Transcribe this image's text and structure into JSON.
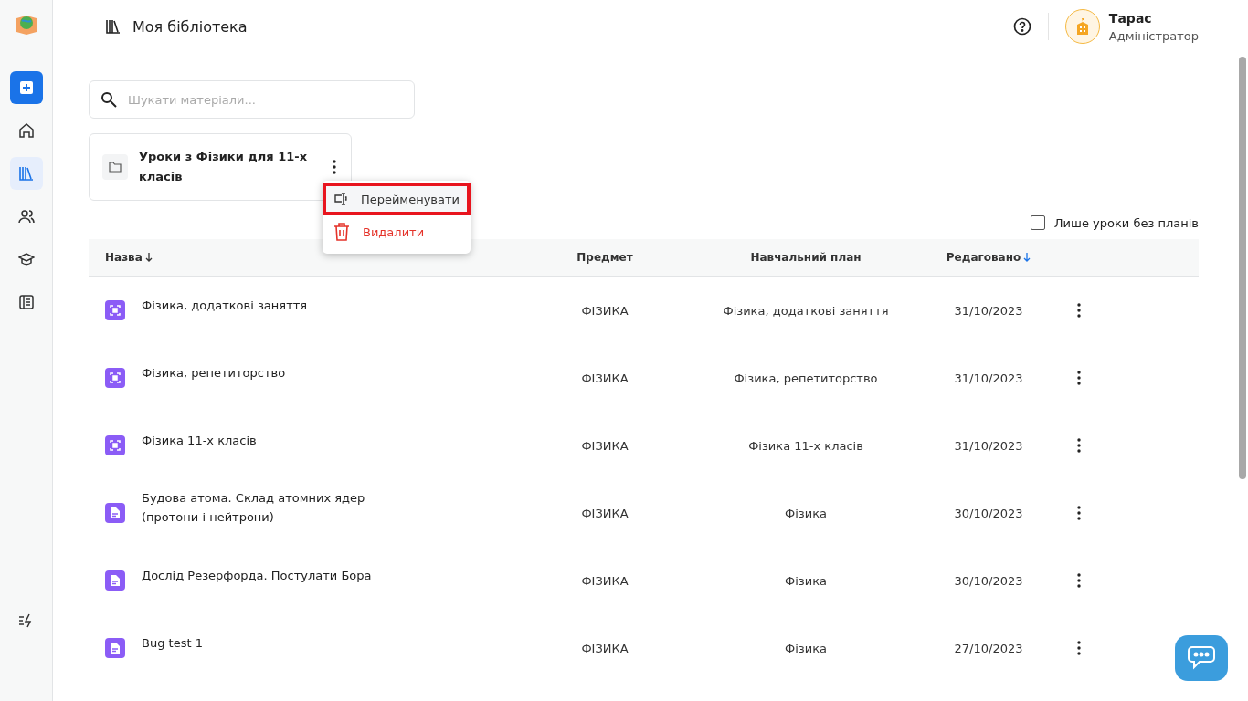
{
  "header": {
    "title": "Моя бібліотека",
    "user": {
      "name": "Тарас",
      "role": "Адміністратор"
    }
  },
  "sidebar": {
    "items": [
      {
        "kind": "home",
        "selected": false
      },
      {
        "kind": "library",
        "selected": true
      },
      {
        "kind": "people",
        "selected": false
      },
      {
        "kind": "courses",
        "selected": false
      },
      {
        "kind": "journal",
        "selected": false
      }
    ]
  },
  "search": {
    "placeholder": "Шукати матеріали..."
  },
  "folders": [
    {
      "name": "Уроки з Фізики для 11-х класів"
    }
  ],
  "context_menu": {
    "items": [
      {
        "label": "Перейменувати",
        "kind": "rename",
        "highlighted": true
      },
      {
        "label": "Видалити",
        "kind": "delete",
        "highlighted": false
      }
    ]
  },
  "filter": {
    "label": "Лише уроки без планів",
    "checked": false
  },
  "table": {
    "columns": [
      {
        "label": "Назва",
        "sorted": true
      },
      {
        "label": "Предмет",
        "sorted": false
      },
      {
        "label": "Навчальний план",
        "sorted": false
      },
      {
        "label": "Редаговано",
        "sorted": true
      }
    ],
    "rows": [
      {
        "kind": "plan",
        "name": "Фізика, додаткові заняття",
        "subject": "ФІЗИКА",
        "plan": "Фізика, додаткові заняття",
        "edited": "31/10/2023"
      },
      {
        "kind": "plan",
        "name": "Фізика, репетиторство",
        "subject": "ФІЗИКА",
        "plan": "Фізика, репетиторство",
        "edited": "31/10/2023"
      },
      {
        "kind": "plan",
        "name": "Фізика 11-х класів",
        "subject": "ФІЗИКА",
        "plan": "Фізика 11-х класів",
        "edited": "31/10/2023"
      },
      {
        "kind": "lesson",
        "name": "Будова атома. Склад атомних ядер (протони і нейтрони)",
        "subject": "ФІЗИКА",
        "plan": "Фізика",
        "edited": "30/10/2023"
      },
      {
        "kind": "lesson",
        "name": "Дослід Резерфорда. Постулати Бора",
        "subject": "ФІЗИКА",
        "plan": "Фізика",
        "edited": "30/10/2023"
      },
      {
        "kind": "lesson",
        "name": "Bug test 1",
        "subject": "ФІЗИКА",
        "plan": "Фізика",
        "edited": "27/10/2023"
      }
    ]
  }
}
